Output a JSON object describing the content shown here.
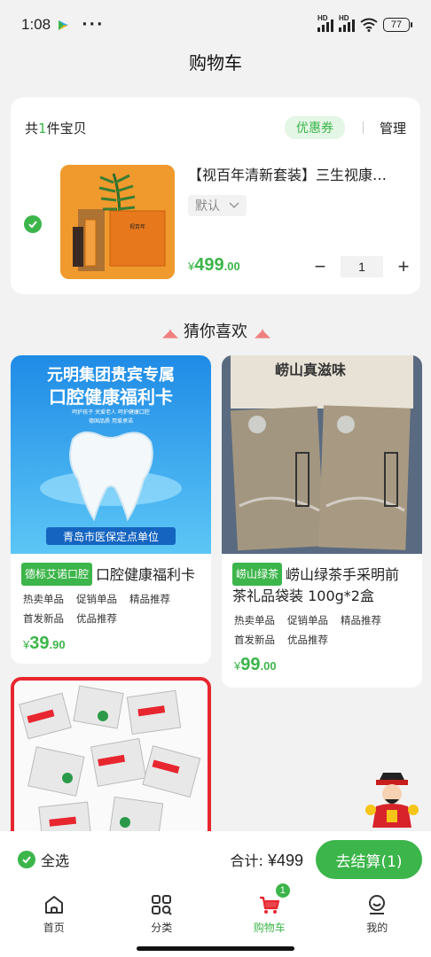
{
  "status": {
    "time": "1:08",
    "battery": "77",
    "network_label": "HD"
  },
  "title": "购物车",
  "cart": {
    "count_prefix": "共",
    "count": "1",
    "count_suffix": "件宝贝",
    "coupon_label": "优惠券",
    "manage_label": "管理",
    "item": {
      "title": "【视百年清新套装】三生视康…",
      "variant": "默认",
      "price_currency": "¥",
      "price_int": "499",
      "price_dec": ".00",
      "quantity": "1",
      "minus": "−",
      "plus": "+"
    }
  },
  "section_title": "猜你喜欢",
  "products": [
    {
      "tag": "德标艾诺口腔",
      "title": "口腔健康福利卡",
      "labels": [
        "热卖单品",
        "促销单品",
        "精品推荐",
        "首发新品",
        "优品推荐"
      ],
      "price_currency": "¥",
      "price_int": "39",
      "price_dec": ".90",
      "banner_line1": "元明集团贵宾专属",
      "banner_line2": "口腔健康福利卡",
      "banner_sub": "呵护孩子 关爱老人 呵护健康口腔",
      "banner_sub2": "德国品质 用爱承诺",
      "banner_footer": "青岛市医保定点单位"
    },
    {
      "tag": "崂山绿茶",
      "title": "崂山绿茶手采明前茶礼品袋装 100g*2盒",
      "labels": [
        "热卖单品",
        "促销单品",
        "精品推荐",
        "首发新品",
        "优品推荐"
      ],
      "price_currency": "¥",
      "price_int": "99",
      "price_dec": ".00",
      "banner_text": "崂山真滋味"
    }
  ],
  "checkout": {
    "select_all": "全选",
    "total_label": "合计:",
    "total_value": "¥499",
    "button": "去结算(1)"
  },
  "tabs": [
    {
      "label": "首页",
      "icon": "home-icon"
    },
    {
      "label": "分类",
      "icon": "category-icon"
    },
    {
      "label": "购物车",
      "icon": "cart-icon",
      "badge": "1"
    },
    {
      "label": "我的",
      "icon": "profile-icon"
    }
  ],
  "colors": {
    "accent": "#3cb54a",
    "background": "#f2f2f2"
  }
}
